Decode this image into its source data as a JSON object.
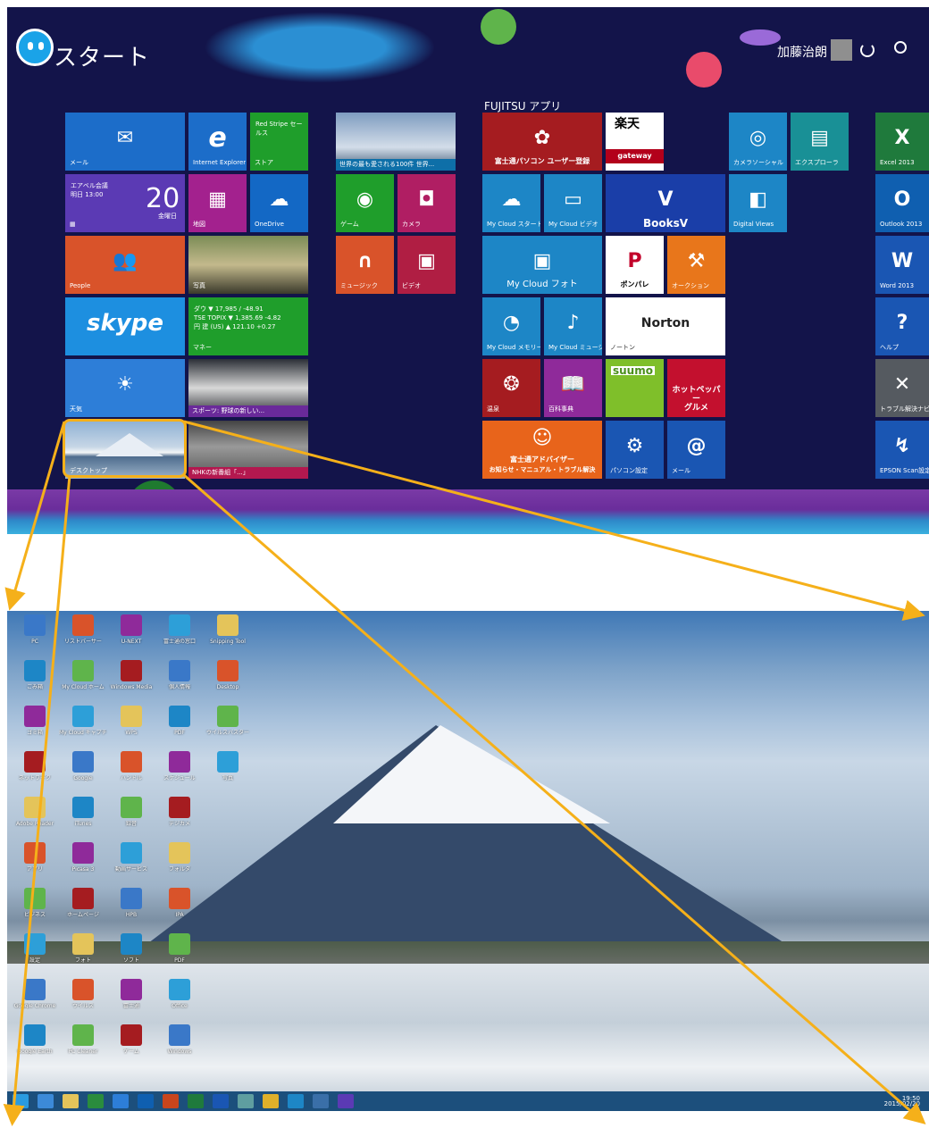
{
  "start": {
    "title": "スタート",
    "user": "加藤治朗",
    "group_title": "FUJITSU アプリ"
  },
  "tiles": [
    {
      "id": "mail",
      "label": "メール",
      "icon": "✉"
    },
    {
      "id": "ie",
      "label": "Internet Explorer",
      "icon": "e"
    },
    {
      "id": "store",
      "label": "ストア",
      "text": "Red Stripe セールス"
    },
    {
      "id": "news",
      "label": "世界の最も愛される100件 世界..."
    },
    {
      "id": "calendar",
      "label": "",
      "text": "エアベル会議\n明日 13:00",
      "date": "20",
      "day": "金曜日"
    },
    {
      "id": "maps",
      "label": "地図",
      "icon": "▦"
    },
    {
      "id": "onedrive",
      "label": "OneDrive",
      "icon": "☁"
    },
    {
      "id": "games",
      "label": "ゲーム",
      "icon": "◉"
    },
    {
      "id": "camera",
      "label": "カメラ",
      "icon": "◘"
    },
    {
      "id": "people",
      "label": "People",
      "icon": "👥"
    },
    {
      "id": "photo-sign",
      "label": "写真"
    },
    {
      "id": "music",
      "label": "ミュージック",
      "icon": "∩"
    },
    {
      "id": "video",
      "label": "ビデオ",
      "icon": "▣"
    },
    {
      "id": "skype",
      "label": "",
      "icon": "skype"
    },
    {
      "id": "finance",
      "label": "マネー",
      "text": "ダウ  ▼ 17,985 / -48.91\nTSE TOPIX ▼ 1,385.69 -4.82\n円 建 (US) ▲ 121.10 +0.27"
    },
    {
      "id": "weather",
      "label": "天気",
      "icon": "☀"
    },
    {
      "id": "sports",
      "label": "スポーツ: 野球の新しい..."
    },
    {
      "id": "desktop",
      "label": "デスクトップ"
    },
    {
      "id": "car-news",
      "label": "NHKの新番組「...」"
    },
    {
      "id": "fujitsu-reg",
      "label": "富士通パソコン ユーザー登録",
      "icon": "✿"
    },
    {
      "id": "rakuten",
      "label": "gateway",
      "text": "楽天"
    },
    {
      "id": "camera-sub",
      "label": "カメラソーシャル",
      "icon": "◎"
    },
    {
      "id": "explorer",
      "label": "エクスプローラ",
      "icon": "▤"
    },
    {
      "id": "excel",
      "label": "Excel 2013",
      "icon": "X"
    },
    {
      "id": "mycloud-start",
      "label": "My Cloud スタート",
      "icon": "☁"
    },
    {
      "id": "mycloud-video",
      "label": "My Cloud ビデオ",
      "icon": "▭"
    },
    {
      "id": "booksv",
      "label": "BooksV",
      "icon": "V"
    },
    {
      "id": "digital",
      "label": "Digital Views",
      "icon": "◧"
    },
    {
      "id": "outlook",
      "label": "Outlook 2013",
      "icon": "O"
    },
    {
      "id": "mycloud-photo",
      "label": "My Cloud フォト",
      "icon": "▣"
    },
    {
      "id": "ponpare",
      "label": "ポンパレ",
      "icon": "P"
    },
    {
      "id": "auction",
      "label": "オークション",
      "icon": "⚒"
    },
    {
      "id": "word",
      "label": "Word 2013",
      "icon": "W"
    },
    {
      "id": "mycloud-memory",
      "label": "My Cloud メモリー",
      "icon": "◔"
    },
    {
      "id": "mycloud-music",
      "label": "My Cloud ミュージック",
      "icon": "♪"
    },
    {
      "id": "norton",
      "label": "ノートン",
      "text": "Norton"
    },
    {
      "id": "help",
      "label": "ヘルプ",
      "icon": "?"
    },
    {
      "id": "onsen",
      "label": "温泉",
      "icon": "❂"
    },
    {
      "id": "hyakka",
      "label": "百科事典",
      "icon": "📖"
    },
    {
      "id": "suumo",
      "label": "SUUMO",
      "text": "suumo"
    },
    {
      "id": "hotpepper",
      "label": "グルメ",
      "text": "ホットペッパー\nグルメ"
    },
    {
      "id": "tools",
      "label": "トラブル解決ナビ",
      "icon": "✕"
    },
    {
      "id": "advisor",
      "label": "富士通アドバイザー",
      "text": "お知らせ・マニュアル・トラブル解決"
    },
    {
      "id": "pcsettings",
      "label": "パソコン設定",
      "icon": "⚙"
    },
    {
      "id": "mail-tool",
      "label": "メール",
      "icon": "@"
    },
    {
      "id": "epson",
      "label": "EPSON Scan設定",
      "icon": "↯"
    }
  ],
  "desktop_icons": [
    "PC",
    "リストバーサー",
    "U-NEXT",
    "富士通の窓口",
    "Snipping Tool",
    "ごみ箱",
    "My Cloud ホーム",
    "Windows Media",
    "個人情報",
    "Desktop",
    "ゴミ箱",
    "My Cloud キャプチャ",
    "WPS",
    "PDF",
    "ウイルスバスター",
    "ネットワーク",
    "Google",
    "ハンドル",
    "スケジュール",
    "写真",
    "Adobe Reader",
    "iTunes",
    "録音",
    "デジカメ",
    "",
    "アプリ",
    "Picasa 3",
    "動画サービス",
    "フォルダ",
    "",
    "ビジネス",
    "ホームページ",
    "HPB",
    "IPA",
    "",
    "設定",
    "フォト",
    "ソフト",
    "PDF",
    "",
    "Google Chrome",
    "ウイルス",
    "富士通",
    "Office",
    "",
    "Google Earth",
    "PC Cleaner",
    "ゲーム",
    "Windows",
    ""
  ],
  "taskbar": {
    "tray_time": "19:50",
    "tray_date": "2015/02/20"
  }
}
